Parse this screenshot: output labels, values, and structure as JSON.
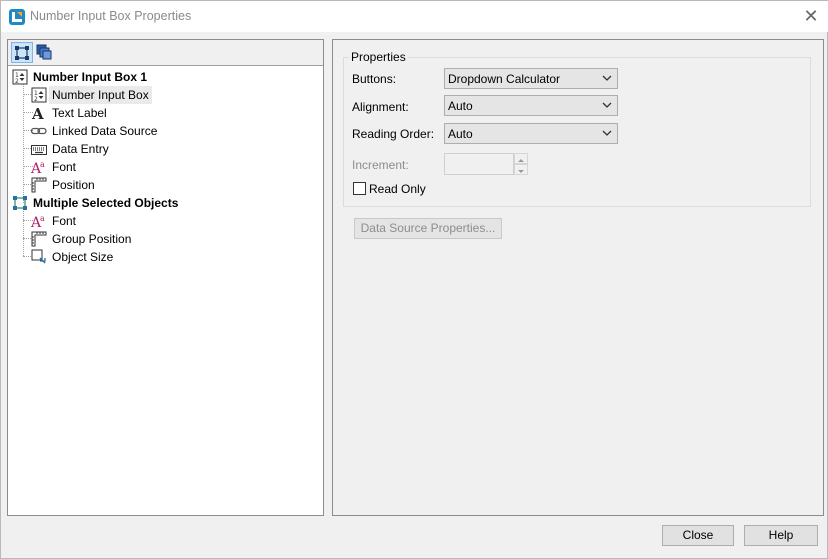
{
  "window": {
    "title": "Number Input Box Properties",
    "close_glyph": "✕"
  },
  "toolbar": {
    "buttons": [
      {
        "icon": "single-object-view-icon",
        "active": true
      },
      {
        "icon": "multiple-objects-view-icon",
        "active": false
      }
    ]
  },
  "tree": {
    "groups": [
      {
        "label": "Number Input Box 1",
        "icon": "number-input-box-icon",
        "items": [
          {
            "label": "Number Input Box",
            "icon": "number-input-box-icon",
            "selected": true
          },
          {
            "label": "Text Label",
            "icon": "text-label-icon"
          },
          {
            "label": "Linked Data Source",
            "icon": "link-chain-icon"
          },
          {
            "label": "Data Entry",
            "icon": "keyboard-icon"
          },
          {
            "label": "Font",
            "icon": "font-icon"
          },
          {
            "label": "Position",
            "icon": "ruler-position-icon"
          }
        ]
      },
      {
        "label": "Multiple Selected Objects",
        "icon": "multiple-objects-icon",
        "items": [
          {
            "label": "Font",
            "icon": "font-icon"
          },
          {
            "label": "Group Position",
            "icon": "ruler-position-icon"
          },
          {
            "label": "Object Size",
            "icon": "object-size-icon"
          }
        ]
      }
    ]
  },
  "properties": {
    "group_label": "Properties",
    "buttons_label": "Buttons:",
    "buttons_value": "Dropdown Calculator",
    "alignment_label": "Alignment:",
    "alignment_value": "Auto",
    "reading_order_label": "Reading Order:",
    "reading_order_value": "Auto",
    "increment_label": "Increment:",
    "increment_value": "",
    "read_only_label": "Read Only",
    "read_only_checked": false,
    "data_source_button": "Data Source Properties..."
  },
  "footer": {
    "close_label": "Close",
    "help_label": "Help"
  },
  "colors": {
    "selection": "#eaeaea",
    "toolbar_active": "#cce4f7",
    "disabled_text": "#8d8d8d"
  }
}
